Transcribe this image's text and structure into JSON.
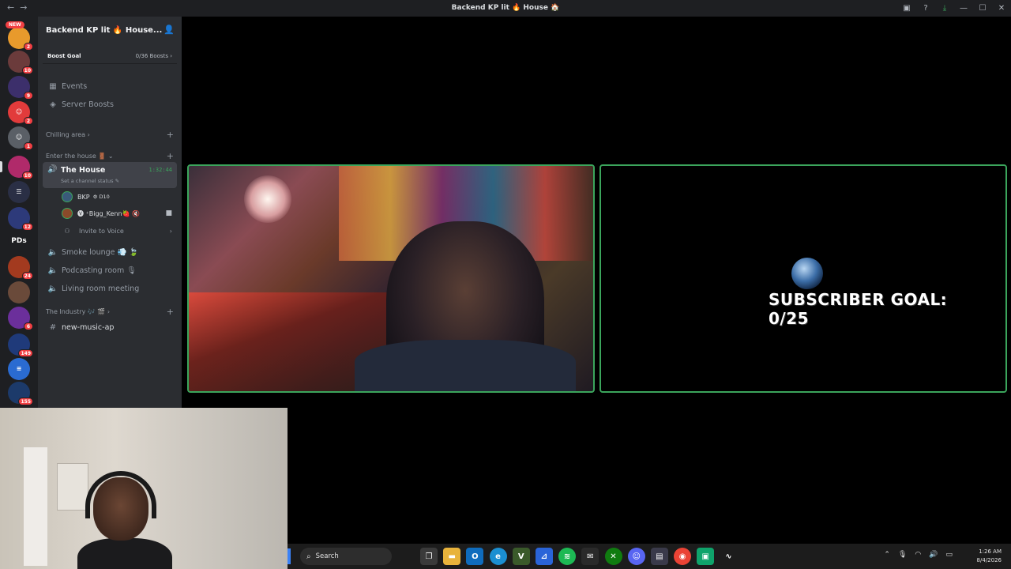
{
  "window": {
    "title": "Backend KP lit 🔥 House 🏠"
  },
  "server": {
    "name": "Backend KP lit 🔥 House...",
    "boost_goal_label": "Boost Goal",
    "boost_count": "0/36 Boosts",
    "events": "Events",
    "server_boosts": "Server Boosts"
  },
  "guild_badges": [
    "NEW",
    "2",
    "10",
    "9",
    "2",
    "1",
    "10",
    "12",
    "PDs",
    "24",
    "6",
    "149",
    "155"
  ],
  "categories": {
    "chilling": "Chilling area",
    "enter_house": "Enter the house 🚪",
    "industry": "The Industry 🎶 🎬"
  },
  "active_channel": {
    "name": "The House",
    "timer": "1:32:44",
    "status": "Set a channel status ✎"
  },
  "voice_users": [
    {
      "name": "BKP",
      "tag": "⚙ D10"
    },
    {
      "name": "🅥 ⁺Bigg_Kenn🍓 🔇",
      "tag": ""
    }
  ],
  "invite": "Invite to Voice",
  "channels": [
    {
      "name": "Smoke lounge 💨 🍃"
    },
    {
      "name": "Podcasting room 🎙"
    },
    {
      "name": "Living room meeting"
    }
  ],
  "text_channel": "new-music-ap",
  "stream": {
    "overlay_text": "SUBSCRIBER GOAL: 0/25"
  },
  "taskbar": {
    "search_placeholder": "Search",
    "time": "1:26 AM",
    "date": "8/4/2026"
  },
  "colors": {
    "accent_green": "#3ba55c",
    "sidebar": "#2b2d31",
    "guild_bar": "#1e1f22"
  }
}
